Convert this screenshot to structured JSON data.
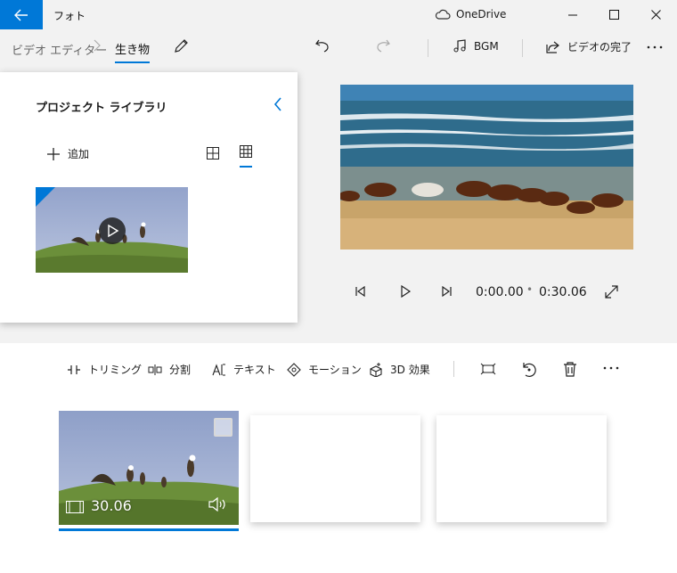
{
  "window": {
    "app_title": "フォト",
    "cloud_label": "OneDrive"
  },
  "breadcrumb": {
    "root": "ビデオ エディター",
    "current": "生き物"
  },
  "toolbar": {
    "bgm_label": "BGM",
    "finish_label": "ビデオの完了"
  },
  "library": {
    "title": "プロジェクト ライブラリ",
    "add_label": "追加"
  },
  "player": {
    "current_time": "0:00.00",
    "separator": "•",
    "total_time": "0:30.06"
  },
  "storyboard_tools": {
    "trim": "トリミング",
    "split": "分割",
    "text": "テキスト",
    "motion": "モーション",
    "effects3d": "3D 効果"
  },
  "clips": [
    {
      "duration": "30.06"
    }
  ],
  "colors": {
    "accent": "#0078d7",
    "background": "#f2f2f2",
    "panel": "#ffffff"
  }
}
